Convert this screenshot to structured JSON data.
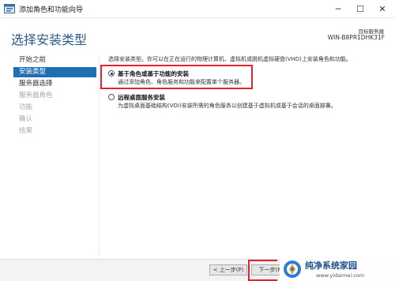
{
  "window": {
    "title": "添加角色和功能向导",
    "minimize": "─",
    "maximize": "☐",
    "close": "✕"
  },
  "header": {
    "heading": "选择安装类型",
    "server_label": "目标服务器",
    "server_name": "WIN-B8PR1DHK31F"
  },
  "nav": {
    "items": [
      {
        "label": "开始之前",
        "state": "normal"
      },
      {
        "label": "安装类型",
        "state": "active"
      },
      {
        "label": "服务器选择",
        "state": "normal"
      },
      {
        "label": "服务器角色",
        "state": "disabled"
      },
      {
        "label": "功能",
        "state": "disabled"
      },
      {
        "label": "确认",
        "state": "disabled"
      },
      {
        "label": "结果",
        "state": "disabled"
      }
    ]
  },
  "content": {
    "intro": "选择安装类型。你可以在正在运行的物理计算机、虚拟机或脱机虚拟硬盘(VHD)上安装角色和功能。",
    "options": [
      {
        "title": "基于角色或基于功能的安装",
        "description": "通过添加角色、角色服务和功能来配置单个服务器。",
        "checked": true
      },
      {
        "title": "远程桌面服务安装",
        "description": "为虚拟桌面基础结构(VDI)安装所需的角色服务以创建基于虚拟机或基于会话的桌面部署。",
        "checked": false
      }
    ]
  },
  "footer": {
    "prev_label": "< 上一步(P)",
    "next_label": "下一步(N"
  },
  "watermark": {
    "title": "纯净系统家园",
    "url": "www.yidaimei.com"
  },
  "colors": {
    "accent": "#1f6fb3",
    "heading": "#2a5c8a",
    "highlight": "#e0242b"
  }
}
